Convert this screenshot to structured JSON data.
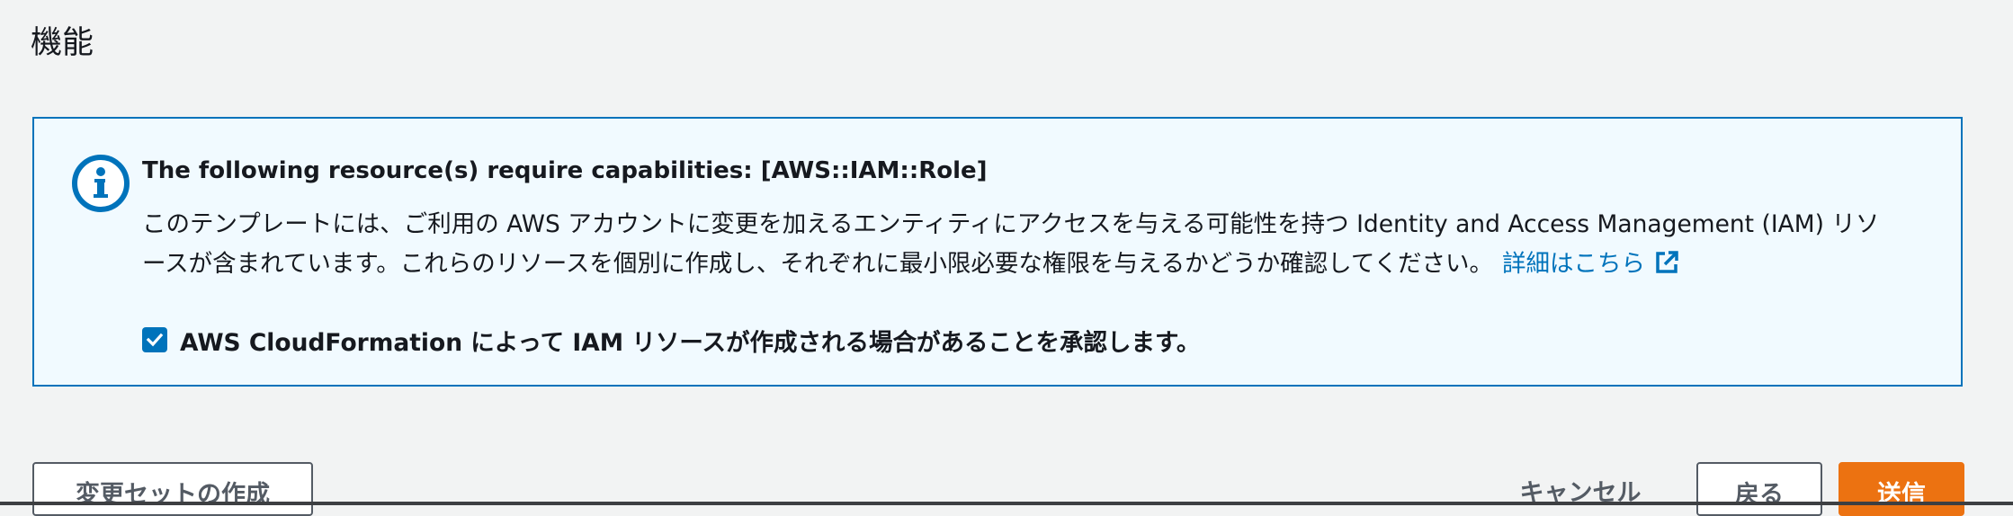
{
  "section": {
    "title": "機能"
  },
  "alert": {
    "type": "info",
    "heading": "The following resource(s) require capabilities: [AWS::IAM::Role]",
    "body_line1": "このテンプレートには、ご利用の AWS アカウントに変更を加えるエンティティにアクセスを与える可能性を持つ Identity and Access Management (IAM) リソ",
    "body_line2": "ースが含まれています。これらのリソースを個別に作成し、それぞれに最小限必要な権限を与えるかどうか確認してください。",
    "learn_more_label": "詳細はこちら",
    "icons": {
      "alert": "info-circle-icon",
      "link": "external-link-icon"
    }
  },
  "acknowledgement": {
    "checked": true,
    "label": "AWS CloudFormation によって IAM リソースが作成される場合があることを承認します。"
  },
  "footer": {
    "create_changeset_label": "変更セットの作成",
    "cancel_label": "キャンセル",
    "back_label": "戻る",
    "submit_label": "送信"
  },
  "colors": {
    "page_background": "#f2f3f3",
    "info_background": "#f1faff",
    "info_border": "#0073bb",
    "link": "#0073bb",
    "primary_button": "#ec7211",
    "secondary_text": "#545b64"
  }
}
